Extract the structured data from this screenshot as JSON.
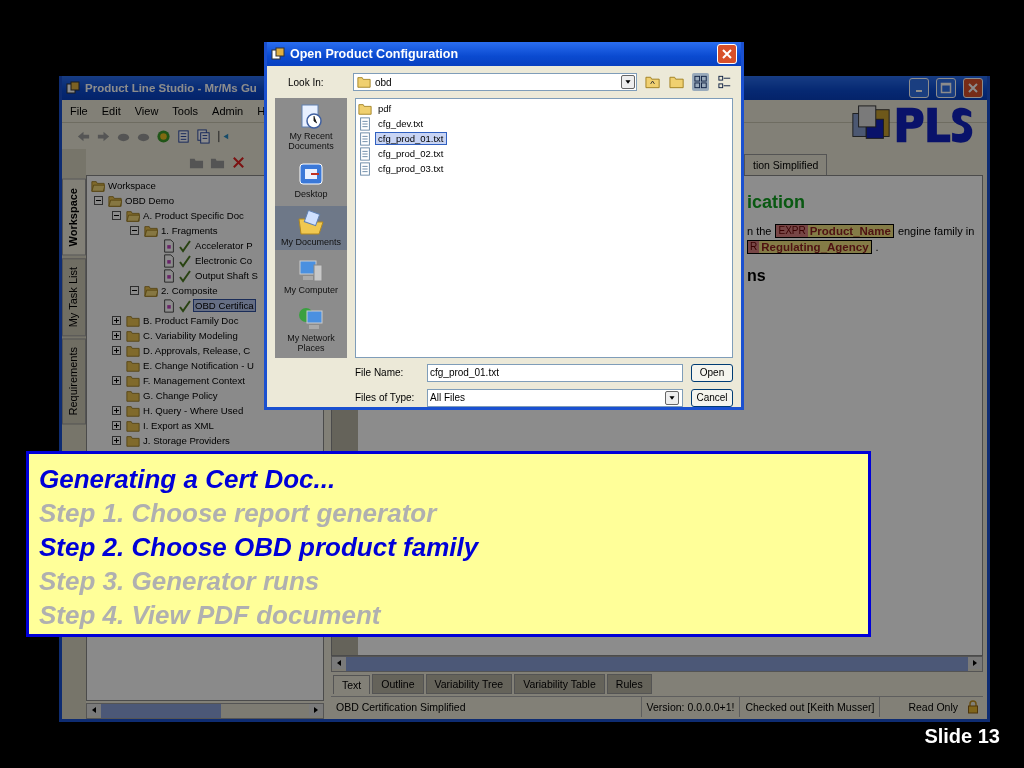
{
  "main_window": {
    "title": "Product Line Studio - Mr/Ms Gu",
    "menu": [
      "File",
      "Edit",
      "View",
      "Tools",
      "Admin",
      "H"
    ],
    "side_tabs": [
      {
        "label": "Workspace",
        "selected": true
      },
      {
        "label": "My Task List",
        "selected": false
      },
      {
        "label": "Requirements",
        "selected": false
      }
    ],
    "tree": {
      "label": "Workspace",
      "kind": "folder",
      "selected": false,
      "children": [
        {
          "label": "OBD Demo",
          "kind": "folder",
          "expanded": true,
          "selected": false,
          "children": [
            {
              "label": "A. Product Specific Doc",
              "kind": "folder",
              "expanded": true,
              "selected": false,
              "children": [
                {
                  "label": "1. Fragments",
                  "kind": "folder",
                  "expanded": true,
                  "selected": false,
                  "children": [
                    {
                      "label": "Accelerator P",
                      "kind": "doc",
                      "checked": true,
                      "selected": false
                    },
                    {
                      "label": "Electronic Co",
                      "kind": "doc",
                      "checked": true,
                      "selected": false
                    },
                    {
                      "label": "Output Shaft S",
                      "kind": "doc",
                      "checked": true,
                      "selected": false
                    }
                  ]
                },
                {
                  "label": "2. Composite",
                  "kind": "folder",
                  "expanded": true,
                  "selected": false,
                  "children": [
                    {
                      "label": "OBD Certifica",
                      "kind": "doc",
                      "checked": true,
                      "selected": true
                    }
                  ]
                }
              ]
            },
            {
              "label": "B. Product Family Doc",
              "kind": "folder",
              "expanded": false,
              "selected": false
            },
            {
              "label": "C. Variability Modeling",
              "kind": "folder",
              "expanded": false,
              "selected": false
            },
            {
              "label": "D. Approvals, Release, C",
              "kind": "folder",
              "expanded": false,
              "selected": false
            },
            {
              "label": "E. Change Notification - U",
              "kind": "folder",
              "selected": false
            },
            {
              "label": "F. Management Context",
              "kind": "folder",
              "expanded": false,
              "selected": false
            },
            {
              "label": "G. Change Policy",
              "kind": "folder",
              "selected": false
            },
            {
              "label": "H. Query - Where Used",
              "kind": "folder",
              "expanded": false,
              "selected": false
            },
            {
              "label": "I. Export as XML",
              "kind": "folder",
              "expanded": false,
              "selected": false
            },
            {
              "label": "J. Storage Providers",
              "kind": "folder",
              "expanded": false,
              "selected": false
            }
          ]
        }
      ]
    },
    "document_tab": {
      "label": "tion Simplified",
      "selected": true
    },
    "document": {
      "heading": "ication",
      "lines": [
        [
          {
            "kind": "text",
            "text": "n the"
          },
          {
            "kind": "expr",
            "tag": "EXPR",
            "name": "Product_Name"
          },
          {
            "kind": "text",
            "text": "engine family in"
          }
        ],
        [
          {
            "kind": "expr",
            "tag": "R",
            "name": "Regulating_Agency"
          },
          {
            "kind": "text",
            "text": "."
          }
        ]
      ],
      "subheading": "ns"
    },
    "view_tabs": [
      {
        "label": "Text",
        "selected": true
      },
      {
        "label": "Outline",
        "selected": false
      },
      {
        "label": "Variability Tree",
        "selected": false
      },
      {
        "label": "Variability Table",
        "selected": false
      },
      {
        "label": "Rules",
        "selected": false
      }
    ],
    "status_bar": [
      "OBD Certification Simplified",
      "Version: 0.0.0.0+1!",
      "Checked out [Keith Musser]",
      "Read Only"
    ]
  },
  "dialog": {
    "title": "Open Product Configuration",
    "look_in_label": "Look In:",
    "look_in": "obd",
    "view_buttons": [
      {
        "kind": "list",
        "selected": true
      },
      {
        "kind": "details",
        "selected": false
      }
    ],
    "places": [
      {
        "label": "My Recent Documents",
        "kind": "recent",
        "selected": false
      },
      {
        "label": "Desktop",
        "kind": "desktop",
        "selected": false
      },
      {
        "label": "My Documents",
        "kind": "documents",
        "selected": true
      },
      {
        "label": "My Computer",
        "kind": "computer",
        "selected": false
      },
      {
        "label": "My Network Places",
        "kind": "network",
        "selected": false
      }
    ],
    "files": [
      {
        "name": "pdf",
        "kind": "folder",
        "selected": false
      },
      {
        "name": "cfg_dev.txt",
        "kind": "file",
        "selected": false
      },
      {
        "name": "cfg_prod_01.txt",
        "kind": "file",
        "selected": true
      },
      {
        "name": "cfg_prod_02.txt",
        "kind": "file",
        "selected": false
      },
      {
        "name": "cfg_prod_03.txt",
        "kind": "file",
        "selected": false
      }
    ],
    "file_name_label": "File Name:",
    "file_name": "cfg_prod_01.txt",
    "file_type_label": "Files of Type:",
    "file_type": "All Files",
    "buttons": [
      "Open",
      "Cancel"
    ]
  },
  "callout": {
    "title": "Generating a Cert Doc...",
    "steps": [
      {
        "text": "Step 1.  Choose report generator",
        "selected": false
      },
      {
        "text": "Step 2.  Choose OBD product family",
        "selected": true
      },
      {
        "text": "Step 3.  Generator runs",
        "selected": false
      },
      {
        "text": "Step 4.  View PDF document",
        "selected": false
      }
    ]
  },
  "slide_number": "Slide 13"
}
